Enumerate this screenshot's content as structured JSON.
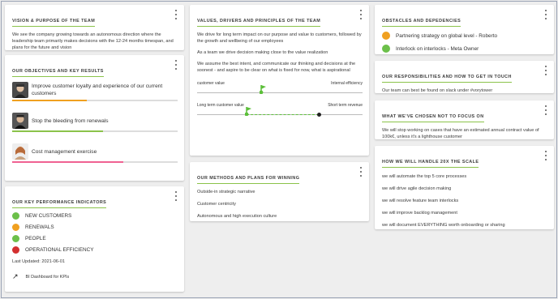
{
  "colors": {
    "accent_green": "#8bc34a",
    "orange": "#f0a020",
    "red": "#d32f2f",
    "pink": "#f06292",
    "kpi_green": "#6cc04a"
  },
  "vision": {
    "title": "VISION & PURPOSE OF THE TEAM",
    "text": "We see the company growing towards an autonomous direction where the leadership team primarily makes decisions with the 12-24 months timespan, and plans for the future and vision"
  },
  "objectives": {
    "title": "OUR OBJECTIVES AND KEY RESULTS",
    "items": [
      {
        "label": "Improve customer loyalty and experience of our current customers",
        "progress": 0.45,
        "color": "orange"
      },
      {
        "label": "Stop the bleeding from renewals",
        "progress": 0.55,
        "color": "green"
      },
      {
        "label": "Cost management exercise",
        "progress": 0.67,
        "color": "pink"
      }
    ]
  },
  "kpis": {
    "title": "OUR KEY PERFORMANCE INDICATORS",
    "items": [
      {
        "label": "NEW CUSTOMERS",
        "status": "green"
      },
      {
        "label": "RENEWALS",
        "status": "orange"
      },
      {
        "label": "PEOPLE",
        "status": "green"
      },
      {
        "label": "OPERATIONAL EFFICIENCY",
        "status": "red"
      }
    ],
    "last_updated": "Last Updated: 2021-06-01",
    "link_label": "BI Dashboard for KPIs",
    "link_icon": "trending-up-icon"
  },
  "values": {
    "title": "VALUES, DRIVERS AND PRINCIPLES OF THE TEAM",
    "paragraphs": [
      "We drive for long term impact on our purpose and value to customers, followed by the growth and wellbeing of our employees",
      "As a team we drive decision making close to the value realization",
      "We assume the best intent, and communicate our thinking and decisions at the soonest - and aspire to be clear on what is fixed for now, what is aspirational"
    ],
    "slider1": {
      "left": "customer value",
      "right": "Internal efficiency",
      "value": 0.39
    },
    "slider2": {
      "left": "Long term customer value",
      "right": "Short term revenue",
      "value": 0.3,
      "target": 0.74
    }
  },
  "methods": {
    "title": "OUR METHODS AND PLANS FOR WINNING",
    "items": [
      "Outside-in strategic narrative",
      "Customer centricity",
      "Autonomous and high execution culture"
    ]
  },
  "obstacles": {
    "title": "OBSTACLES AND DEPEDENCIES",
    "items": [
      {
        "label": "Partnering strategy on global level - Roberto",
        "status": "orange"
      },
      {
        "label": "Interlock on interlocks - Meta Owner",
        "status": "green"
      }
    ]
  },
  "responsibilities": {
    "title": "OUR RESPONSIBILITIES AND HOW TO GET IN TOUCH",
    "text": "Our team can best be found on slack under #vorytower"
  },
  "not_focus": {
    "title": "WHAT WE'VE CHOSEN NOT TO FOCUS ON",
    "text": "We will stop working on cases that have an estimated annual contract value of 100k€, unless it's a lighthouse customer"
  },
  "scale": {
    "title": "HOW WE WILL HANDLE 20X THE SCALE",
    "items": [
      "we will automate the top 5 core processes",
      "we will drive agile decision making",
      "we will resolve feature team interlocks",
      "we will improve backlog management",
      "we will document EVERYTHING worth onboarding or sharing"
    ]
  }
}
